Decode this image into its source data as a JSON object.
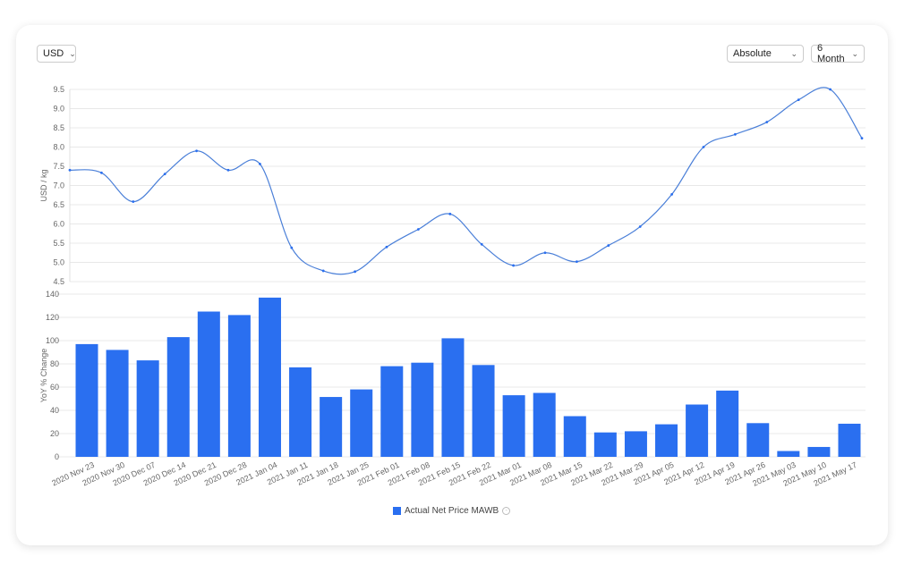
{
  "controls": {
    "currency": "USD",
    "mode": "Absolute",
    "period": "6 Month"
  },
  "chart_data": [
    {
      "type": "line",
      "ylabel": "USD / kg",
      "ylim": [
        4.5,
        9.5
      ],
      "yticks": [
        "9.5",
        "9.0",
        "8.5",
        "8.0",
        "7.5",
        "7.0",
        "6.5",
        "6.0",
        "5.5",
        "5.0",
        "4.5"
      ],
      "grid": true,
      "color": "#2a6ff0",
      "x": [
        "2020 Nov 23",
        "2020 Nov 30",
        "2020 Dec 07",
        "2020 Dec 14",
        "2020 Dec 21",
        "2020 Dec 28",
        "2021 Jan 04",
        "2021 Jan 11",
        "2021 Jan 18",
        "2021 Jan 25",
        "2021 Feb 01",
        "2021 Feb 08",
        "2021 Feb 15",
        "2021 Feb 22",
        "2021 Mar 01",
        "2021 Mar 08",
        "2021 Mar 15",
        "2021 Mar 22",
        "2021 Mar 29",
        "2021 Apr 05",
        "2021 Apr 12",
        "2021 Apr 19",
        "2021 Apr 26",
        "2021 May 03",
        "2021 May 10",
        "2021 May 17"
      ],
      "values": [
        7.4,
        7.33,
        6.58,
        7.3,
        7.9,
        7.4,
        7.56,
        5.38,
        4.78,
        4.76,
        5.4,
        5.86,
        6.26,
        5.47,
        4.92,
        5.25,
        5.02,
        5.44,
        5.93,
        6.77,
        8.0,
        8.33,
        8.65,
        9.23,
        9.5,
        8.23
      ]
    },
    {
      "type": "bar",
      "ylabel": "YoY % Change",
      "ylim": [
        0,
        140
      ],
      "yticks": [
        "140",
        "120",
        "100",
        "80",
        "60",
        "40",
        "20",
        "0"
      ],
      "grid": true,
      "color": "#2a6ff0",
      "categories": [
        "2020 Nov 23",
        "2020 Nov 30",
        "2020 Dec 07",
        "2020 Dec 14",
        "2020 Dec 21",
        "2020 Dec 28",
        "2021 Jan 04",
        "2021 Jan 11",
        "2021 Jan 18",
        "2021 Jan 25",
        "2021 Feb 01",
        "2021 Feb 08",
        "2021 Feb 15",
        "2021 Feb 22",
        "2021 Mar 01",
        "2021 Mar 08",
        "2021 Mar 15",
        "2021 Mar 22",
        "2021 Mar 29",
        "2021 Apr 05",
        "2021 Apr 12",
        "2021 Apr 19",
        "2021 Apr 26",
        "2021 May 03",
        "2021 May 10",
        "2021 May 17"
      ],
      "values": [
        97,
        92,
        83,
        103,
        125,
        122,
        137,
        77,
        51.5,
        58,
        78,
        81,
        102,
        79,
        53,
        55,
        35,
        21,
        22,
        28,
        45,
        57,
        29,
        5,
        8.5,
        28.5
      ],
      "legend": "Actual Net Price MAWB",
      "legend_position": "bottom"
    }
  ]
}
